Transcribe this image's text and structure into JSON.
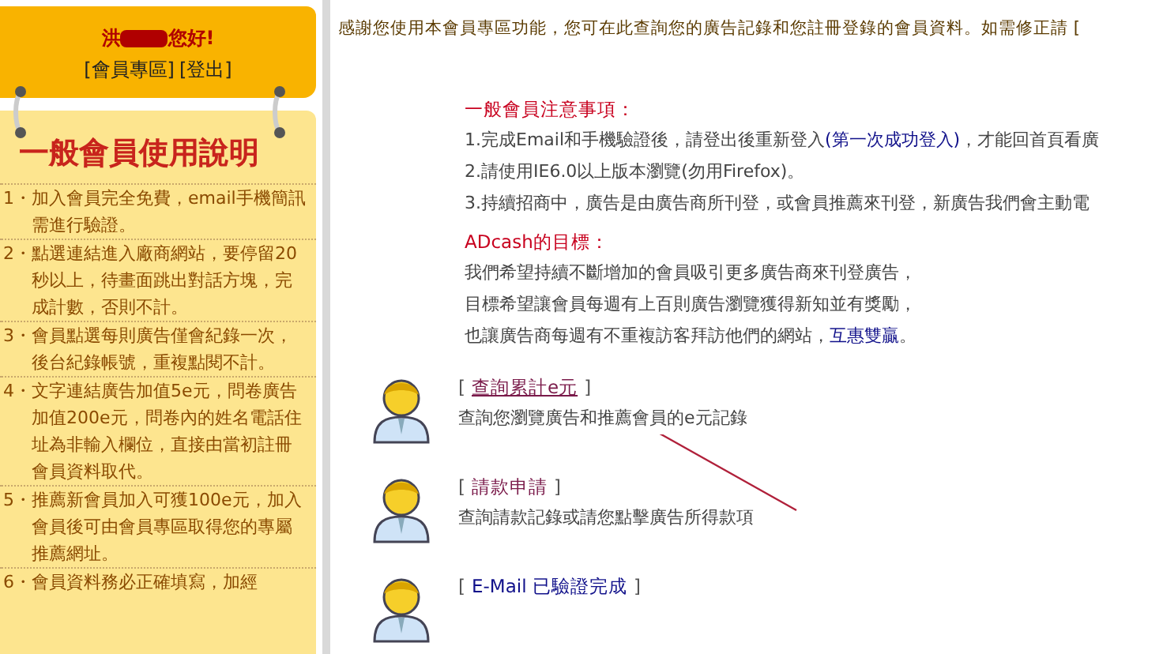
{
  "sidebar": {
    "greeting": {
      "prefix": "洪",
      "redacted": true,
      "suffix": "您好!"
    },
    "links": [
      "[會員專區]",
      "[登出]"
    ],
    "title": "一般會員使用說明",
    "items": [
      {
        "number": "1・",
        "text": "加入會員完全免費，email手機簡訊需進行驗證。"
      },
      {
        "number": "2・",
        "text": "點選連結進入廠商網站，要停留20秒以上，待畫面跳出對話方塊，完成計數，否則不計。"
      },
      {
        "number": "3・",
        "text": "會員點選每則廣告僅會紀錄一次，後台紀錄帳號，重複點閱不計。"
      },
      {
        "number": "4・",
        "text": "文字連結廣告加值5e元，問卷廣告加值200e元，問卷內的姓名電話住址為非輸入欄位，直接由當初註冊會員資料取代。"
      },
      {
        "number": "5・",
        "text": "推薦新會員加入可獲100e元，加入會員後可由會員專區取得您的專屬推薦網址。"
      },
      {
        "number": "6・",
        "text": "會員資料務必正確填寫，加經"
      }
    ]
  },
  "main": {
    "intro": "感謝您使用本會員專區功能，您可在此查詢您的廣告記錄和您註冊登錄的會員資料。如需修正請 [",
    "notice": {
      "title": "一般會員注意事項：",
      "lines": [
        {
          "text": "1.完成Email和手機驗證後，請登出後重新登入",
          "link": "(第一次成功登入)",
          "after": "，才能回首頁看廣"
        },
        {
          "text": "2.請使用IE6.0以上版本瀏覽(勿用Firefox)。"
        },
        {
          "text": "3.持續招商中，廣告是由廣告商所刊登，或會員推薦來刊登，新廣告我們會主動電"
        }
      ]
    },
    "goal": {
      "title": "ADcash的目標：",
      "lines": [
        {
          "text": "我們希望持續不斷增加的會員吸引更多廣告商來刊登廣告，"
        },
        {
          "text": "目標希望讓會員每週有上百則廣告瀏覽獲得新知並有獎勵，"
        },
        {
          "text": "也讓廣告商每週有不重複訪客拜訪他們的網站，",
          "link": "互惠雙贏",
          "after": "。"
        }
      ]
    },
    "actions": [
      {
        "open": "[",
        "label": "查詢累計e元",
        "close": "]",
        "visited": true,
        "underlined": true,
        "description": "查詢您瀏覽廣告和推薦會員的e元記錄"
      },
      {
        "open": "[",
        "label": "請款申請",
        "close": "]",
        "visited": true,
        "underlined": false,
        "description": "查詢請款記錄或請您點擊廣告所得款項"
      },
      {
        "open": "[",
        "label": "E-Mail 已驗證完成",
        "close": "]",
        "visited": false,
        "underlined": false
      }
    ]
  }
}
